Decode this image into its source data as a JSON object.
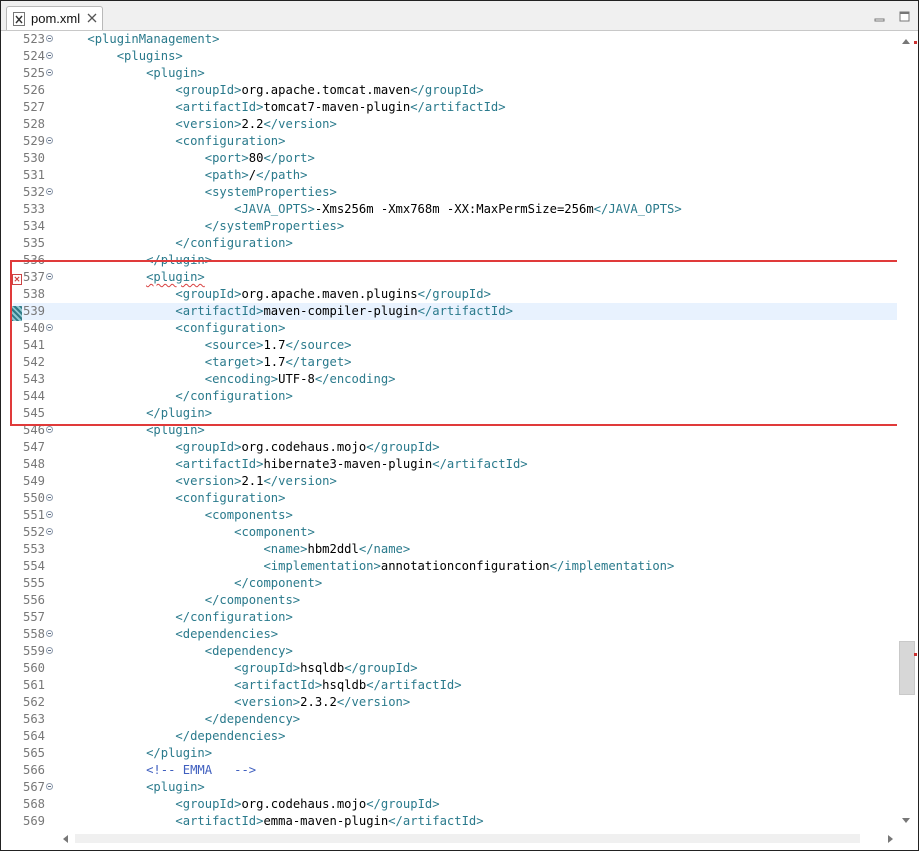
{
  "tab": {
    "title": "pom.xml",
    "icon": "xml-file-icon"
  },
  "window_controls": [
    "minimize-icon",
    "maximize-icon"
  ],
  "lines": [
    {
      "n": "523",
      "fold": true,
      "ind": 4,
      "t": [
        [
          "tag",
          "<pluginManagement>"
        ]
      ]
    },
    {
      "n": "524",
      "fold": true,
      "ind": 8,
      "t": [
        [
          "tag",
          "<plugins>"
        ]
      ]
    },
    {
      "n": "525",
      "fold": true,
      "ind": 12,
      "t": [
        [
          "tag",
          "<plugin>"
        ]
      ]
    },
    {
      "n": "526",
      "fold": false,
      "ind": 16,
      "t": [
        [
          "tag",
          "<groupId>"
        ],
        [
          "txt",
          "org.apache.tomcat.maven"
        ],
        [
          "tag",
          "</groupId>"
        ]
      ]
    },
    {
      "n": "527",
      "fold": false,
      "ind": 16,
      "t": [
        [
          "tag",
          "<artifactId>"
        ],
        [
          "txt",
          "tomcat7-maven-plugin"
        ],
        [
          "tag",
          "</artifactId>"
        ]
      ]
    },
    {
      "n": "528",
      "fold": false,
      "ind": 16,
      "t": [
        [
          "tag",
          "<version>"
        ],
        [
          "txt",
          "2.2"
        ],
        [
          "tag",
          "</version>"
        ]
      ]
    },
    {
      "n": "529",
      "fold": true,
      "ind": 16,
      "t": [
        [
          "tag",
          "<configuration>"
        ]
      ]
    },
    {
      "n": "530",
      "fold": false,
      "ind": 20,
      "t": [
        [
          "tag",
          "<port>"
        ],
        [
          "txt",
          "80"
        ],
        [
          "tag",
          "</port>"
        ]
      ]
    },
    {
      "n": "531",
      "fold": false,
      "ind": 20,
      "t": [
        [
          "tag",
          "<path>"
        ],
        [
          "txt",
          "/"
        ],
        [
          "tag",
          "</path>"
        ]
      ]
    },
    {
      "n": "532",
      "fold": true,
      "ind": 20,
      "t": [
        [
          "tag",
          "<systemProperties>"
        ]
      ]
    },
    {
      "n": "533",
      "fold": false,
      "ind": 24,
      "t": [
        [
          "tag",
          "<JAVA_OPTS>"
        ],
        [
          "txt",
          "-Xms256m -Xmx768m -XX:MaxPermSize=256m"
        ],
        [
          "tag",
          "</JAVA_OPTS>"
        ]
      ]
    },
    {
      "n": "534",
      "fold": false,
      "ind": 20,
      "t": [
        [
          "tag",
          "</systemProperties>"
        ]
      ]
    },
    {
      "n": "535",
      "fold": false,
      "ind": 16,
      "t": [
        [
          "tag",
          "</configuration>"
        ]
      ]
    },
    {
      "n": "536",
      "fold": false,
      "ind": 12,
      "t": [
        [
          "tag",
          "</plugin>"
        ]
      ]
    },
    {
      "n": "537",
      "fold": true,
      "ind": 12,
      "t": [
        [
          "tag",
          "<plugin>"
        ]
      ],
      "squig": true,
      "error": true
    },
    {
      "n": "538",
      "fold": false,
      "ind": 16,
      "t": [
        [
          "tag",
          "<groupId>"
        ],
        [
          "txt",
          "org.apache.maven.plugins"
        ],
        [
          "tag",
          "</groupId>"
        ]
      ]
    },
    {
      "n": "539",
      "fold": false,
      "ind": 16,
      "t": [
        [
          "tag",
          "<artifactId>"
        ],
        [
          "txt",
          "maven-compiler-plugin"
        ],
        [
          "tag",
          "</artifactId>"
        ]
      ],
      "current": true
    },
    {
      "n": "540",
      "fold": true,
      "ind": 16,
      "t": [
        [
          "tag",
          "<configuration>"
        ]
      ]
    },
    {
      "n": "541",
      "fold": false,
      "ind": 20,
      "t": [
        [
          "tag",
          "<source>"
        ],
        [
          "txt",
          "1.7"
        ],
        [
          "tag",
          "</source>"
        ]
      ]
    },
    {
      "n": "542",
      "fold": false,
      "ind": 20,
      "t": [
        [
          "tag",
          "<target>"
        ],
        [
          "txt",
          "1.7"
        ],
        [
          "tag",
          "</target>"
        ]
      ]
    },
    {
      "n": "543",
      "fold": false,
      "ind": 20,
      "t": [
        [
          "tag",
          "<encoding>"
        ],
        [
          "txt",
          "UTF-8"
        ],
        [
          "tag",
          "</encoding>"
        ]
      ]
    },
    {
      "n": "544",
      "fold": false,
      "ind": 16,
      "t": [
        [
          "tag",
          "</configuration>"
        ]
      ]
    },
    {
      "n": "545",
      "fold": false,
      "ind": 12,
      "t": [
        [
          "tag",
          "</plugin>"
        ]
      ]
    },
    {
      "n": "546",
      "fold": true,
      "ind": 12,
      "t": [
        [
          "tag",
          "<plugin>"
        ]
      ]
    },
    {
      "n": "547",
      "fold": false,
      "ind": 16,
      "t": [
        [
          "tag",
          "<groupId>"
        ],
        [
          "txt",
          "org.codehaus.mojo"
        ],
        [
          "tag",
          "</groupId>"
        ]
      ]
    },
    {
      "n": "548",
      "fold": false,
      "ind": 16,
      "t": [
        [
          "tag",
          "<artifactId>"
        ],
        [
          "txt",
          "hibernate3-maven-plugin"
        ],
        [
          "tag",
          "</artifactId>"
        ]
      ]
    },
    {
      "n": "549",
      "fold": false,
      "ind": 16,
      "t": [
        [
          "tag",
          "<version>"
        ],
        [
          "txt",
          "2.1"
        ],
        [
          "tag",
          "</version>"
        ]
      ]
    },
    {
      "n": "550",
      "fold": true,
      "ind": 16,
      "t": [
        [
          "tag",
          "<configuration>"
        ]
      ]
    },
    {
      "n": "551",
      "fold": true,
      "ind": 20,
      "t": [
        [
          "tag",
          "<components>"
        ]
      ]
    },
    {
      "n": "552",
      "fold": true,
      "ind": 24,
      "t": [
        [
          "tag",
          "<component>"
        ]
      ]
    },
    {
      "n": "553",
      "fold": false,
      "ind": 28,
      "t": [
        [
          "tag",
          "<name>"
        ],
        [
          "txt",
          "hbm2ddl"
        ],
        [
          "tag",
          "</name>"
        ]
      ]
    },
    {
      "n": "554",
      "fold": false,
      "ind": 28,
      "t": [
        [
          "tag",
          "<implementation>"
        ],
        [
          "txt",
          "annotationconfiguration"
        ],
        [
          "tag",
          "</implementation>"
        ]
      ]
    },
    {
      "n": "555",
      "fold": false,
      "ind": 24,
      "t": [
        [
          "tag",
          "</component>"
        ]
      ]
    },
    {
      "n": "556",
      "fold": false,
      "ind": 20,
      "t": [
        [
          "tag",
          "</components>"
        ]
      ]
    },
    {
      "n": "557",
      "fold": false,
      "ind": 16,
      "t": [
        [
          "tag",
          "</configuration>"
        ]
      ]
    },
    {
      "n": "558",
      "fold": true,
      "ind": 16,
      "t": [
        [
          "tag",
          "<dependencies>"
        ]
      ]
    },
    {
      "n": "559",
      "fold": true,
      "ind": 20,
      "t": [
        [
          "tag",
          "<dependency>"
        ]
      ]
    },
    {
      "n": "560",
      "fold": false,
      "ind": 24,
      "t": [
        [
          "tag",
          "<groupId>"
        ],
        [
          "txt",
          "hsqldb"
        ],
        [
          "tag",
          "</groupId>"
        ]
      ]
    },
    {
      "n": "561",
      "fold": false,
      "ind": 24,
      "t": [
        [
          "tag",
          "<artifactId>"
        ],
        [
          "txt",
          "hsqldb"
        ],
        [
          "tag",
          "</artifactId>"
        ]
      ]
    },
    {
      "n": "562",
      "fold": false,
      "ind": 24,
      "t": [
        [
          "tag",
          "<version>"
        ],
        [
          "txt",
          "2.3.2"
        ],
        [
          "tag",
          "</version>"
        ]
      ]
    },
    {
      "n": "563",
      "fold": false,
      "ind": 20,
      "t": [
        [
          "tag",
          "</dependency>"
        ]
      ]
    },
    {
      "n": "564",
      "fold": false,
      "ind": 16,
      "t": [
        [
          "tag",
          "</dependencies>"
        ]
      ]
    },
    {
      "n": "565",
      "fold": false,
      "ind": 12,
      "t": [
        [
          "tag",
          "</plugin>"
        ]
      ]
    },
    {
      "n": "566",
      "fold": false,
      "ind": 12,
      "t": [
        [
          "cmt",
          "<!-- EMMA   -->"
        ]
      ]
    },
    {
      "n": "567",
      "fold": true,
      "ind": 12,
      "t": [
        [
          "tag",
          "<plugin>"
        ]
      ]
    },
    {
      "n": "568",
      "fold": false,
      "ind": 16,
      "t": [
        [
          "tag",
          "<groupId>"
        ],
        [
          "txt",
          "org.codehaus.mojo"
        ],
        [
          "tag",
          "</groupId>"
        ]
      ]
    },
    {
      "n": "569",
      "fold": false,
      "ind": 16,
      "t": [
        [
          "tag",
          "<artifactId>"
        ],
        [
          "txt",
          "emma-maven-plugin"
        ],
        [
          "tag",
          "</artifactId>"
        ]
      ]
    }
  ],
  "colors": {
    "tag": "#2a7a8c",
    "text": "#000000",
    "comment": "#3f5fbf",
    "current_line": "#e8f2fe",
    "highlight_box": "#e03a3a"
  }
}
